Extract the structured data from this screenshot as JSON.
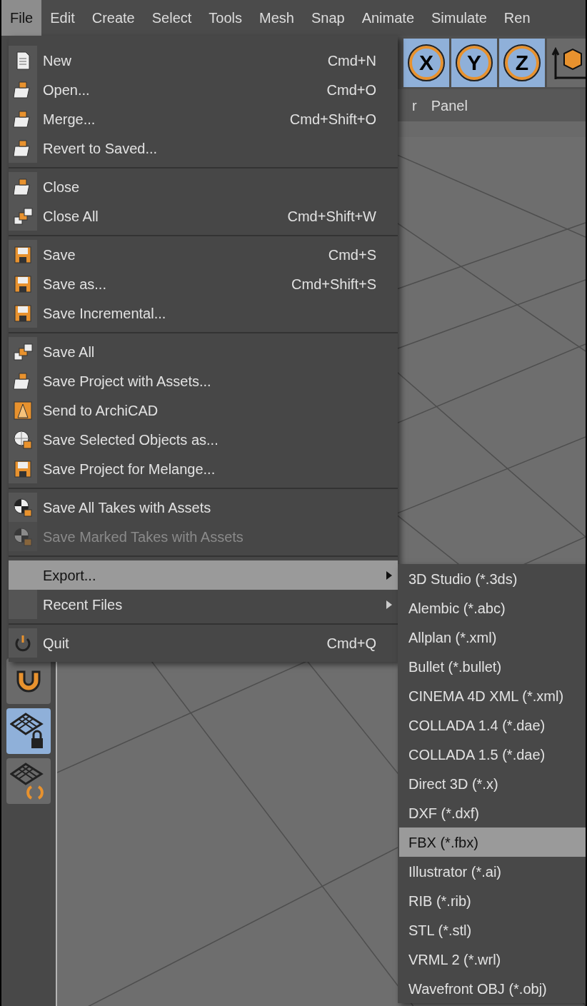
{
  "menu_bar": {
    "items": [
      {
        "label": "File",
        "selected": true
      },
      {
        "label": "Edit",
        "selected": false
      },
      {
        "label": "Create",
        "selected": false
      },
      {
        "label": "Select",
        "selected": false
      },
      {
        "label": "Tools",
        "selected": false
      },
      {
        "label": "Mesh",
        "selected": false
      },
      {
        "label": "Snap",
        "selected": false
      },
      {
        "label": "Animate",
        "selected": false
      },
      {
        "label": "Simulate",
        "selected": false
      },
      {
        "label": "Ren",
        "selected": false
      }
    ]
  },
  "toolbar": {
    "axis_buttons": [
      {
        "label": "X",
        "selected": true
      },
      {
        "label": "Y",
        "selected": true
      },
      {
        "label": "Z",
        "selected": true
      }
    ]
  },
  "panel_bar": {
    "items": [
      "r",
      "Panel"
    ]
  },
  "sidebar": {
    "tools": [
      {
        "selected": false
      },
      {
        "selected": true
      },
      {
        "selected": false
      }
    ]
  },
  "file_menu": {
    "sections": [
      {
        "items": [
          {
            "label": "New",
            "shortcut": "Cmd+N",
            "kind": "command",
            "selected": false,
            "disabled": false
          },
          {
            "label": "Open...",
            "shortcut": "Cmd+O",
            "kind": "command",
            "selected": false,
            "disabled": false
          },
          {
            "label": "Merge...",
            "shortcut": "Cmd+Shift+O",
            "kind": "command",
            "selected": false,
            "disabled": false
          },
          {
            "label": "Revert to Saved...",
            "kind": "command",
            "selected": false,
            "disabled": false
          }
        ]
      },
      {
        "items": [
          {
            "label": "Close",
            "kind": "command",
            "selected": false,
            "disabled": false
          },
          {
            "label": "Close All",
            "shortcut": "Cmd+Shift+W",
            "kind": "command",
            "selected": false,
            "disabled": false
          }
        ]
      },
      {
        "items": [
          {
            "label": "Save",
            "shortcut": "Cmd+S",
            "kind": "command",
            "selected": false,
            "disabled": false
          },
          {
            "label": "Save as...",
            "shortcut": "Cmd+Shift+S",
            "kind": "command",
            "selected": false,
            "disabled": false
          },
          {
            "label": "Save Incremental...",
            "kind": "command",
            "selected": false,
            "disabled": false
          }
        ]
      },
      {
        "items": [
          {
            "label": "Save All",
            "kind": "command",
            "selected": false,
            "disabled": false
          },
          {
            "label": "Save Project with Assets...",
            "kind": "command",
            "selected": false,
            "disabled": false
          },
          {
            "label": "Send to ArchiCAD",
            "kind": "command",
            "selected": false,
            "disabled": false
          },
          {
            "label": "Save Selected Objects as...",
            "kind": "command",
            "selected": false,
            "disabled": false
          },
          {
            "label": "Save Project for Melange...",
            "kind": "command",
            "selected": false,
            "disabled": false
          }
        ]
      },
      {
        "items": [
          {
            "label": "Save All Takes with Assets",
            "kind": "command",
            "selected": false,
            "disabled": false
          },
          {
            "label": "Save Marked Takes with Assets",
            "kind": "command",
            "selected": false,
            "disabled": true
          }
        ]
      },
      {
        "items": [
          {
            "label": "Export...",
            "kind": "submenu",
            "selected": true,
            "disabled": false
          },
          {
            "label": "Recent Files",
            "kind": "submenu",
            "selected": false,
            "disabled": false
          }
        ]
      },
      {
        "items": [
          {
            "label": "Quit",
            "shortcut": "Cmd+Q",
            "kind": "command",
            "selected": false,
            "disabled": false
          }
        ]
      }
    ]
  },
  "export_submenu": {
    "items": [
      {
        "label": "3D Studio (*.3ds)",
        "selected": false
      },
      {
        "label": "Alembic (*.abc)",
        "selected": false
      },
      {
        "label": "Allplan (*.xml)",
        "selected": false
      },
      {
        "label": "Bullet (*.bullet)",
        "selected": false
      },
      {
        "label": "CINEMA 4D XML (*.xml)",
        "selected": false
      },
      {
        "label": "COLLADA 1.4 (*.dae)",
        "selected": false
      },
      {
        "label": "COLLADA 1.5 (*.dae)",
        "selected": false
      },
      {
        "label": "Direct 3D (*.x)",
        "selected": false
      },
      {
        "label": "DXF (*.dxf)",
        "selected": false
      },
      {
        "label": "FBX (*.fbx)",
        "selected": true
      },
      {
        "label": "Illustrator (*.ai)",
        "selected": false
      },
      {
        "label": "RIB (*.rib)",
        "selected": false
      },
      {
        "label": "STL (*.stl)",
        "selected": false
      },
      {
        "label": "VRML 2 (*.wrl)",
        "selected": false
      },
      {
        "label": "Wavefront OBJ (*.obj)",
        "selected": false
      }
    ]
  }
}
